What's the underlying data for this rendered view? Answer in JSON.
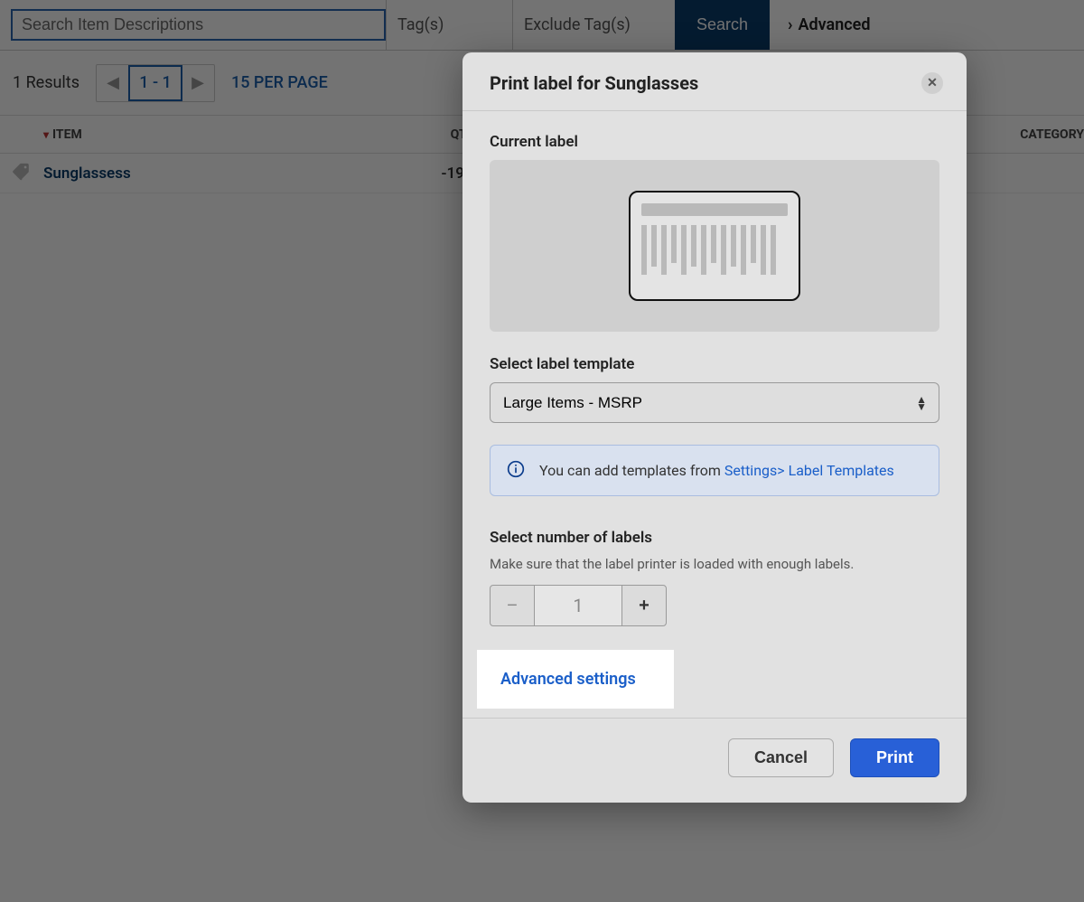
{
  "search": {
    "placeholder": "Search Item Descriptions",
    "tags_label": "Tag(s)",
    "exclude_label": "Exclude Tag(s)",
    "search_btn": "Search",
    "advanced_label": "Advanced"
  },
  "results": {
    "count_text": "1 Results",
    "range": "1 - 1",
    "per_page": "15 PER PAGE"
  },
  "table": {
    "headers": {
      "item": "ITEM",
      "qty": "QTY.",
      "category": "CATEGORY"
    },
    "rows": [
      {
        "name": "Sunglassess",
        "qty": "-19"
      }
    ]
  },
  "modal": {
    "title": "Print label for Sunglasses",
    "current_label": "Current label",
    "select_template_label": "Select label template",
    "template_options": [
      "Large Items - MSRP"
    ],
    "template_selected": "Large Items - MSRP",
    "info_text": "You can add templates from ",
    "info_link": "Settings> Label Templates",
    "number_labels_title": "Select number of labels",
    "number_labels_sub": "Make sure that the label printer is loaded with enough labels.",
    "quantity": "1",
    "advanced_settings_label": "Advanced settings",
    "cancel_btn": "Cancel",
    "print_btn": "Print"
  }
}
